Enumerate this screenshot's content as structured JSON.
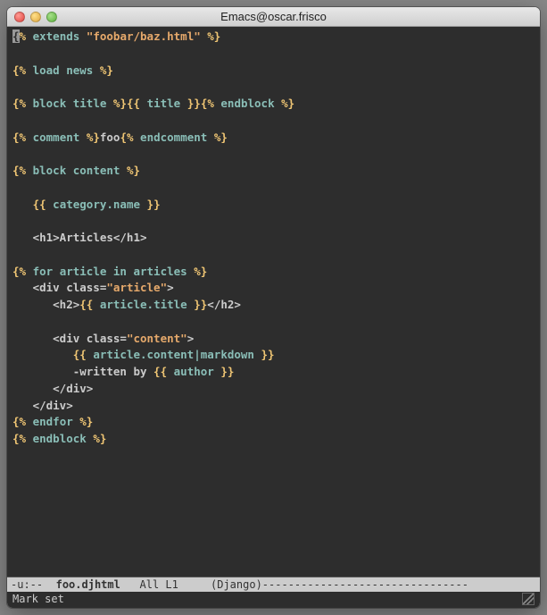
{
  "window": {
    "title": "Emacs@oscar.frisco"
  },
  "code": {
    "l1": {
      "kw": "extends",
      "str": "\"foobar/baz.html\""
    },
    "l2": {
      "kw": "load news"
    },
    "l3": {
      "kw1": "block title",
      "var": "title",
      "kw2": "endblock"
    },
    "l4": {
      "kw1": "comment",
      "txt": "foo",
      "kw2": "endcomment"
    },
    "l5": {
      "kw": "block content"
    },
    "l6": {
      "var": "category.name"
    },
    "l7": {
      "txt": "<h1>Articles</h1>"
    },
    "l8": {
      "kw": "for article in articles"
    },
    "l9": {
      "txt1": "<div class=",
      "str": "\"article\"",
      "txt2": ">"
    },
    "l10": {
      "txt1": "<h2>",
      "var": "article.title",
      "txt2": "</h2>"
    },
    "l11": {
      "txt1": "<div class=",
      "str": "\"content\"",
      "txt2": ">"
    },
    "l12": {
      "var": "article.content|markdown"
    },
    "l13": {
      "txt1": "-written by ",
      "var": "author"
    },
    "l14": {
      "txt": "</div>"
    },
    "l15": {
      "txt": "</div>"
    },
    "l16": {
      "kw": "endfor"
    },
    "l17": {
      "kw": "endblock"
    }
  },
  "modeline": {
    "left": "-u:-- ",
    "filename": "foo.djhtml",
    "position": "   All L1    ",
    "mode": "(Django)",
    "dashes": "--------------------------------"
  },
  "minibuffer": {
    "text": "Mark set"
  }
}
